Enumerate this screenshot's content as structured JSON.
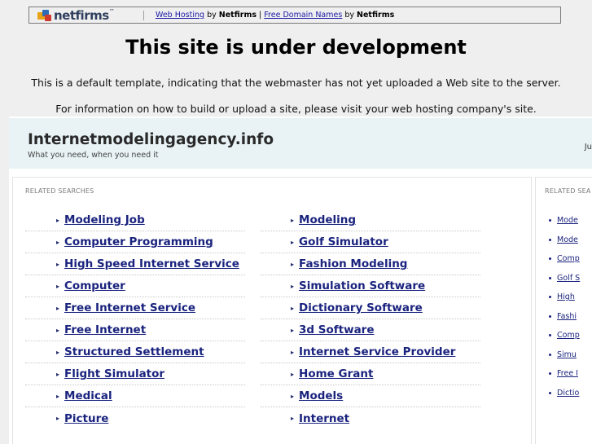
{
  "topbar": {
    "logo_text": "netfirms",
    "logo_tm": "™",
    "link1": "Web Hosting",
    "by1": "by",
    "brand1": "Netfirms",
    "divider": "|",
    "link2": "Free Domain Names",
    "by2": "by",
    "brand2": "Netfirms"
  },
  "headline": "This site is under development",
  "info_line_1": "This is a default template, indicating that the webmaster has not yet uploaded a Web site to the server.",
  "info_line_2": "For information on how to build or upload a site, please visit your web hosting company's site.",
  "site": {
    "title": "Internetmodelingagency.info",
    "tagline": "What you need, when you need it",
    "header_cut_text": "Ju"
  },
  "main": {
    "heading": "RELATED SEARCHES",
    "left_links": [
      "Modeling Job",
      "Computer Programming",
      "High Speed Internet Service",
      "Computer",
      "Free Internet Service",
      "Free Internet",
      "Structured Settlement",
      "Flight Simulator",
      "Medical",
      "Picture"
    ],
    "right_links": [
      "Modeling",
      "Golf Simulator",
      "Fashion Modeling",
      "Simulation Software",
      "Dictionary Software",
      "3d Software",
      "Internet Service Provider",
      "Home Grant",
      "Models",
      "Internet"
    ]
  },
  "side": {
    "heading": "RELATED SEA",
    "links": [
      "Mode",
      "Mode",
      "Comp",
      "Golf S",
      "High",
      "Fashi",
      "Comp",
      "Simu",
      "Free I",
      "Dictio"
    ]
  },
  "icons": {
    "arrow": "▸"
  }
}
